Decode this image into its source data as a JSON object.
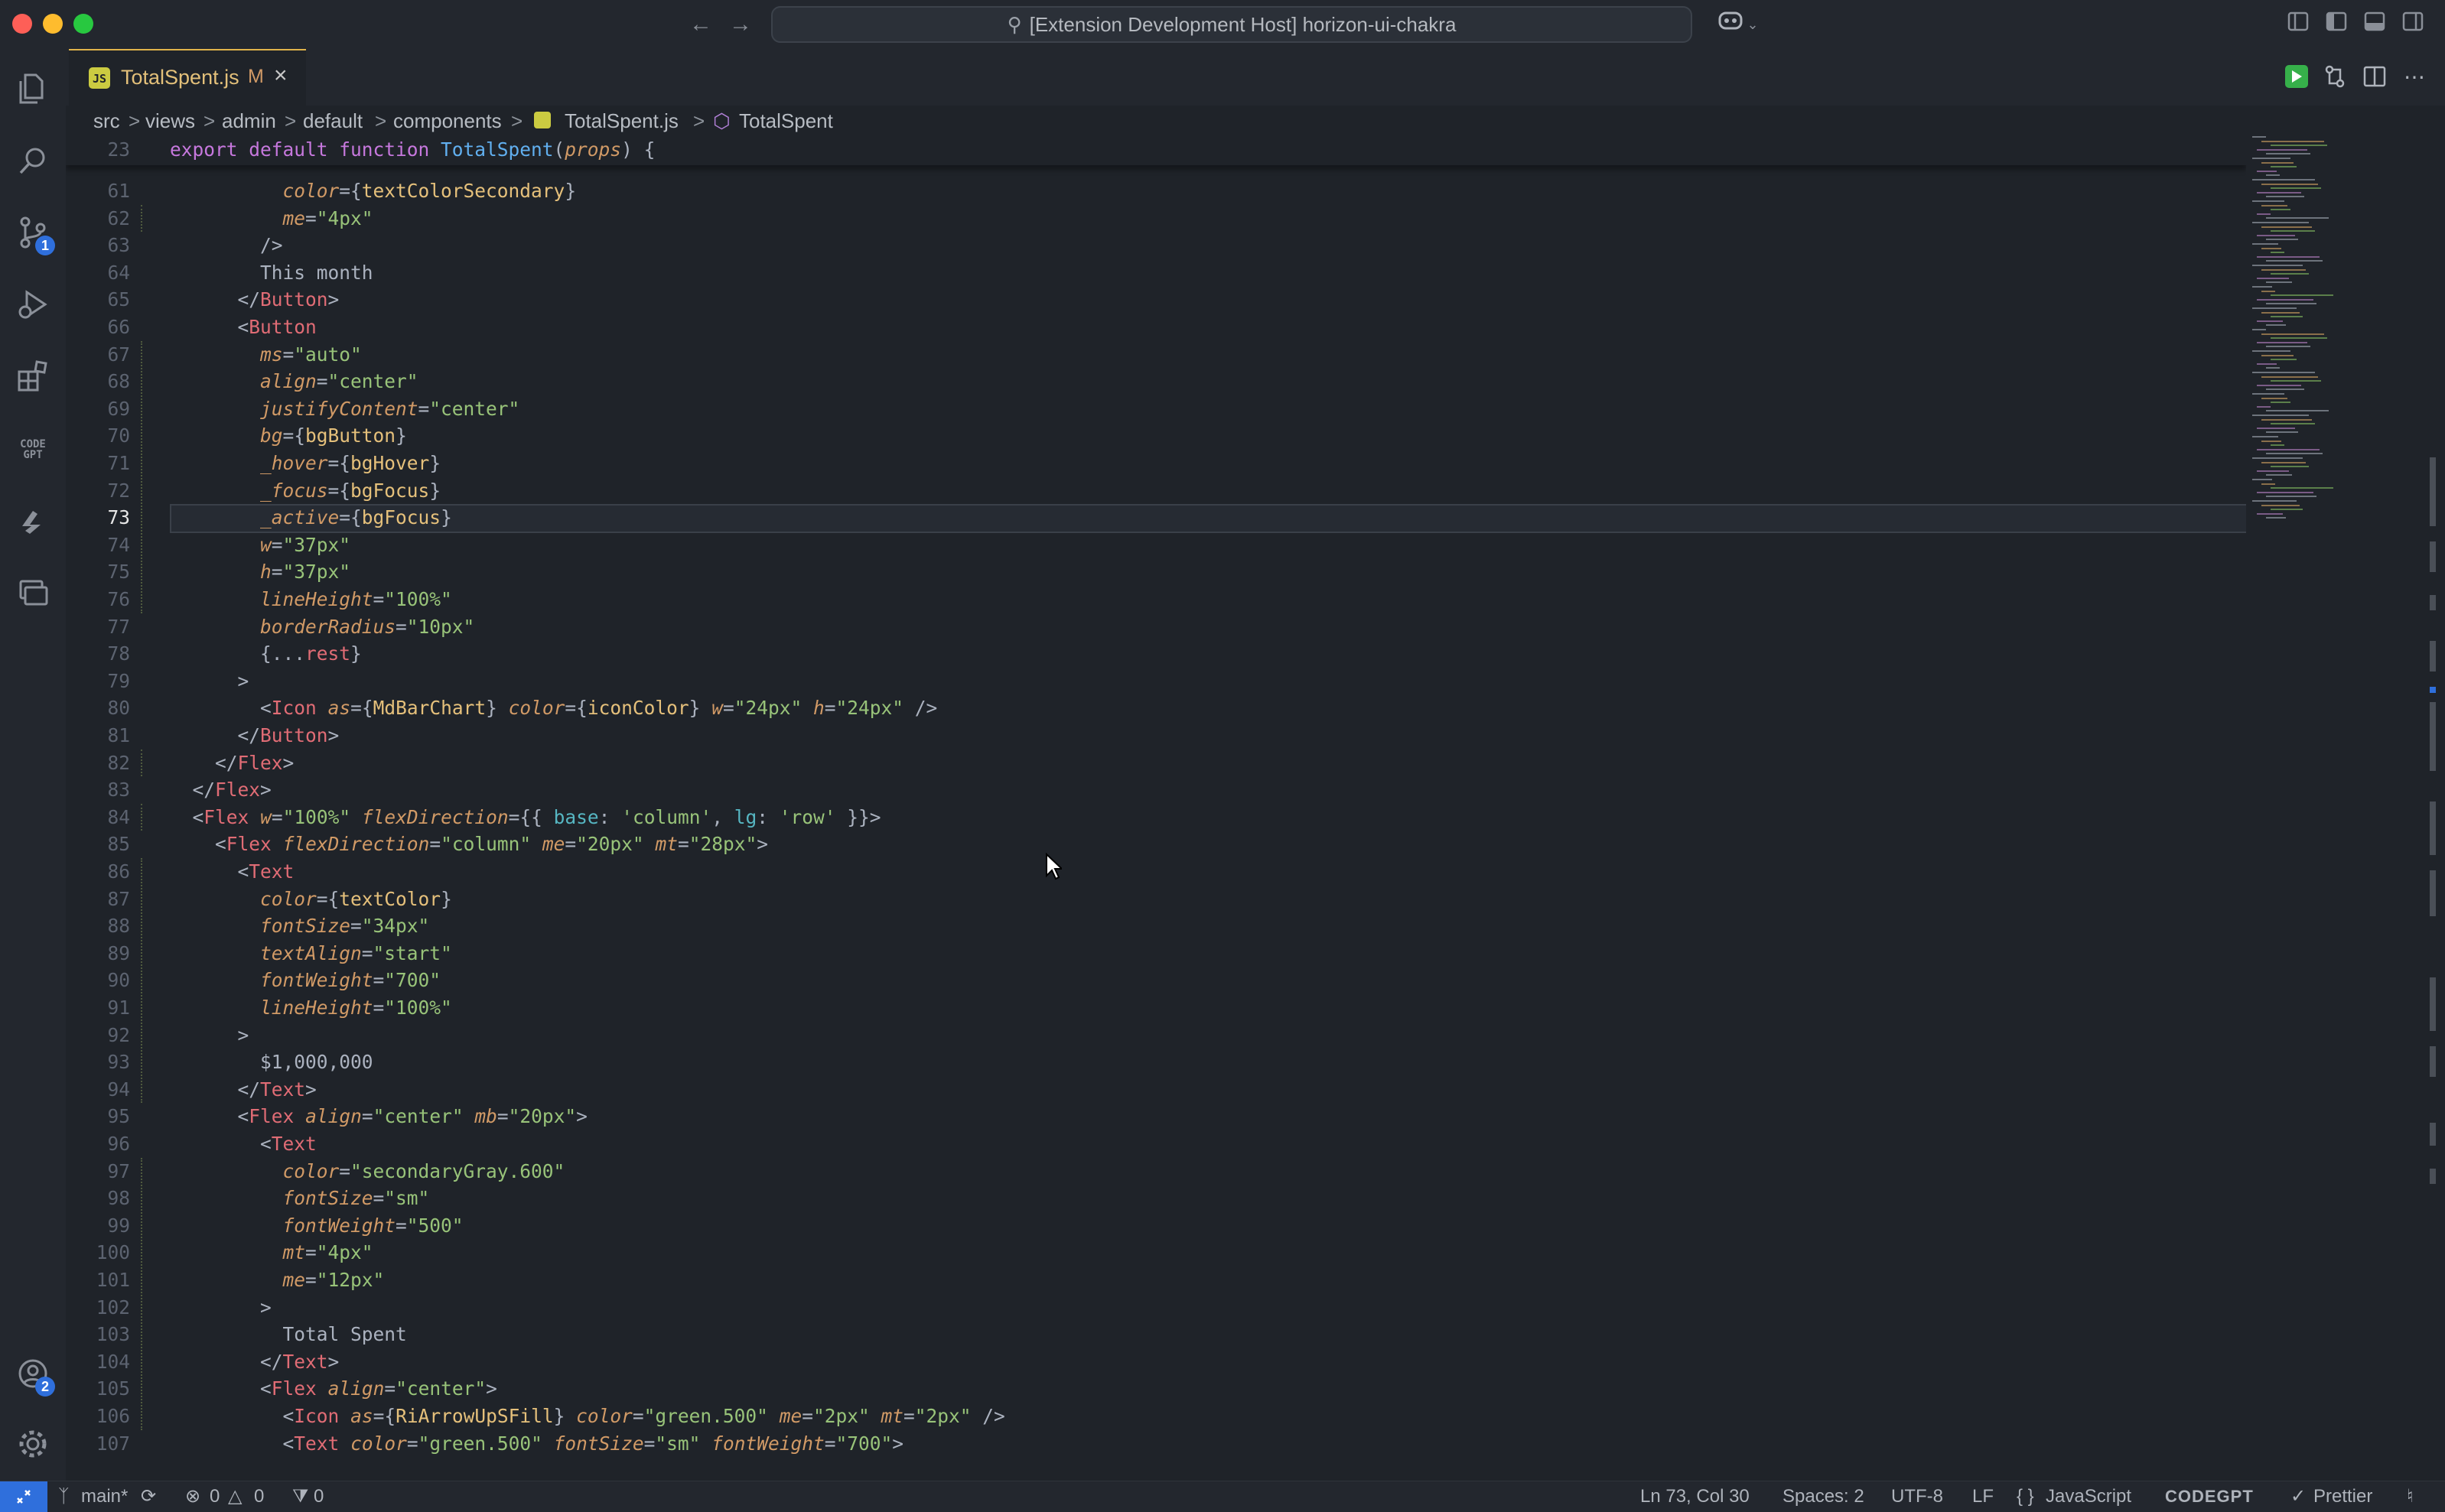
{
  "window": {
    "title": "[Extension Development Host] horizon-ui-chakra"
  },
  "tab": {
    "js_badge": "JS",
    "filename": "TotalSpent.js",
    "modified": "M"
  },
  "breadcrumb": [
    "src",
    "views",
    "admin",
    "default",
    "components",
    "TotalSpent.js",
    "TotalSpent"
  ],
  "activity": {
    "scm_badge": "1",
    "accounts_badge": "2",
    "codegpt_label": "CODE GPT"
  },
  "sticky": {
    "num": "23",
    "segs": [
      [
        "kw",
        "export default function "
      ],
      [
        "fn",
        "TotalSpent"
      ],
      [
        "pu",
        "("
      ],
      [
        "at",
        "props"
      ],
      [
        "pu",
        ") {"
      ]
    ]
  },
  "editor": {
    "cursor_line": "73",
    "lines": [
      {
        "num": "61",
        "indent": "          ",
        "segs": [
          [
            "at",
            "color"
          ],
          [
            "pu",
            "={"
          ],
          [
            "va",
            "textColorSecondary"
          ],
          [
            "pu",
            "}"
          ]
        ]
      },
      {
        "num": "62",
        "indent": "          ",
        "segs": [
          [
            "at",
            "me"
          ],
          [
            "pu",
            "="
          ],
          [
            "st",
            "\"4px\""
          ]
        ]
      },
      {
        "num": "63",
        "indent": "        ",
        "segs": [
          [
            "pu",
            "/>"
          ]
        ]
      },
      {
        "num": "64",
        "indent": "        ",
        "segs": [
          [
            "pu",
            "This month"
          ]
        ]
      },
      {
        "num": "65",
        "indent": "      ",
        "segs": [
          [
            "pu",
            "</"
          ],
          [
            "tg",
            "Button"
          ],
          [
            "pu",
            ">"
          ]
        ]
      },
      {
        "num": "66",
        "indent": "      ",
        "segs": [
          [
            "pu",
            "<"
          ],
          [
            "tg",
            "Button"
          ]
        ]
      },
      {
        "num": "67",
        "indent": "        ",
        "segs": [
          [
            "at",
            "ms"
          ],
          [
            "pu",
            "="
          ],
          [
            "st",
            "\"auto\""
          ]
        ]
      },
      {
        "num": "68",
        "indent": "        ",
        "segs": [
          [
            "at",
            "align"
          ],
          [
            "pu",
            "="
          ],
          [
            "st",
            "\"center\""
          ]
        ]
      },
      {
        "num": "69",
        "indent": "        ",
        "segs": [
          [
            "at",
            "justifyContent"
          ],
          [
            "pu",
            "="
          ],
          [
            "st",
            "\"center\""
          ]
        ]
      },
      {
        "num": "70",
        "indent": "        ",
        "segs": [
          [
            "at",
            "bg"
          ],
          [
            "pu",
            "={"
          ],
          [
            "va",
            "bgButton"
          ],
          [
            "pu",
            "}"
          ]
        ]
      },
      {
        "num": "71",
        "indent": "        ",
        "segs": [
          [
            "at",
            "_hover"
          ],
          [
            "pu",
            "={"
          ],
          [
            "va",
            "bgHover"
          ],
          [
            "pu",
            "}"
          ]
        ]
      },
      {
        "num": "72",
        "indent": "        ",
        "segs": [
          [
            "at",
            "_focus"
          ],
          [
            "pu",
            "={"
          ],
          [
            "va",
            "bgFocus"
          ],
          [
            "pu",
            "}"
          ]
        ]
      },
      {
        "num": "73",
        "indent": "        ",
        "segs": [
          [
            "at",
            "_active"
          ],
          [
            "pu",
            "={"
          ],
          [
            "va",
            "bgFocus"
          ],
          [
            "pu",
            "}"
          ]
        ]
      },
      {
        "num": "74",
        "indent": "        ",
        "segs": [
          [
            "at",
            "w"
          ],
          [
            "pu",
            "="
          ],
          [
            "st",
            "\"37px\""
          ]
        ]
      },
      {
        "num": "75",
        "indent": "        ",
        "segs": [
          [
            "at",
            "h"
          ],
          [
            "pu",
            "="
          ],
          [
            "st",
            "\"37px\""
          ]
        ]
      },
      {
        "num": "76",
        "indent": "        ",
        "segs": [
          [
            "at",
            "lineHeight"
          ],
          [
            "pu",
            "="
          ],
          [
            "st",
            "\"100%\""
          ]
        ]
      },
      {
        "num": "77",
        "indent": "        ",
        "segs": [
          [
            "at",
            "borderRadius"
          ],
          [
            "pu",
            "="
          ],
          [
            "st",
            "\"10px\""
          ]
        ]
      },
      {
        "num": "78",
        "indent": "        ",
        "segs": [
          [
            "pu",
            "{..."
          ],
          [
            "tg",
            "rest"
          ],
          [
            "pu",
            "}"
          ]
        ]
      },
      {
        "num": "79",
        "indent": "      ",
        "segs": [
          [
            "pu",
            ">"
          ]
        ]
      },
      {
        "num": "80",
        "indent": "        ",
        "segs": [
          [
            "pu",
            "<"
          ],
          [
            "tg",
            "Icon"
          ],
          [
            "pu",
            " "
          ],
          [
            "at",
            "as"
          ],
          [
            "pu",
            "={"
          ],
          [
            "va",
            "MdBarChart"
          ],
          [
            "pu",
            "} "
          ],
          [
            "at",
            "color"
          ],
          [
            "pu",
            "={"
          ],
          [
            "va",
            "iconColor"
          ],
          [
            "pu",
            "} "
          ],
          [
            "at",
            "w"
          ],
          [
            "pu",
            "="
          ],
          [
            "st",
            "\"24px\""
          ],
          [
            "pu",
            " "
          ],
          [
            "at",
            "h"
          ],
          [
            "pu",
            "="
          ],
          [
            "st",
            "\"24px\""
          ],
          [
            "pu",
            " />"
          ]
        ]
      },
      {
        "num": "81",
        "indent": "      ",
        "segs": [
          [
            "pu",
            "</"
          ],
          [
            "tg",
            "Button"
          ],
          [
            "pu",
            ">"
          ]
        ]
      },
      {
        "num": "82",
        "indent": "    ",
        "segs": [
          [
            "pu",
            "</"
          ],
          [
            "tg",
            "Flex"
          ],
          [
            "pu",
            ">"
          ]
        ]
      },
      {
        "num": "83",
        "indent": "  ",
        "segs": [
          [
            "pu",
            "</"
          ],
          [
            "tg",
            "Flex"
          ],
          [
            "pu",
            ">"
          ]
        ]
      },
      {
        "num": "84",
        "indent": "  ",
        "segs": [
          [
            "pu",
            "<"
          ],
          [
            "tg",
            "Flex"
          ],
          [
            "pu",
            " "
          ],
          [
            "at",
            "w"
          ],
          [
            "pu",
            "="
          ],
          [
            "st",
            "\"100%\""
          ],
          [
            "pu",
            " "
          ],
          [
            "at",
            "flexDirection"
          ],
          [
            "pu",
            "={{ "
          ],
          [
            "cy",
            "base"
          ],
          [
            "pu",
            ": "
          ],
          [
            "st",
            "'column'"
          ],
          [
            "pu",
            ", "
          ],
          [
            "cy",
            "lg"
          ],
          [
            "pu",
            ": "
          ],
          [
            "st",
            "'row'"
          ],
          [
            "pu",
            " }}>"
          ]
        ]
      },
      {
        "num": "85",
        "indent": "    ",
        "segs": [
          [
            "pu",
            "<"
          ],
          [
            "tg",
            "Flex"
          ],
          [
            "pu",
            " "
          ],
          [
            "at",
            "flexDirection"
          ],
          [
            "pu",
            "="
          ],
          [
            "st",
            "\"column\""
          ],
          [
            "pu",
            " "
          ],
          [
            "at",
            "me"
          ],
          [
            "pu",
            "="
          ],
          [
            "st",
            "\"20px\""
          ],
          [
            "pu",
            " "
          ],
          [
            "at",
            "mt"
          ],
          [
            "pu",
            "="
          ],
          [
            "st",
            "\"28px\""
          ],
          [
            "pu",
            ">"
          ]
        ]
      },
      {
        "num": "86",
        "indent": "      ",
        "segs": [
          [
            "pu",
            "<"
          ],
          [
            "tg",
            "Text"
          ]
        ]
      },
      {
        "num": "87",
        "indent": "        ",
        "segs": [
          [
            "at",
            "color"
          ],
          [
            "pu",
            "={"
          ],
          [
            "va",
            "textColor"
          ],
          [
            "pu",
            "}"
          ]
        ]
      },
      {
        "num": "88",
        "indent": "        ",
        "segs": [
          [
            "at",
            "fontSize"
          ],
          [
            "pu",
            "="
          ],
          [
            "st",
            "\"34px\""
          ]
        ]
      },
      {
        "num": "89",
        "indent": "        ",
        "segs": [
          [
            "at",
            "textAlign"
          ],
          [
            "pu",
            "="
          ],
          [
            "st",
            "\"start\""
          ]
        ]
      },
      {
        "num": "90",
        "indent": "        ",
        "segs": [
          [
            "at",
            "fontWeight"
          ],
          [
            "pu",
            "="
          ],
          [
            "st",
            "\"700\""
          ]
        ]
      },
      {
        "num": "91",
        "indent": "        ",
        "segs": [
          [
            "at",
            "lineHeight"
          ],
          [
            "pu",
            "="
          ],
          [
            "st",
            "\"100%\""
          ]
        ]
      },
      {
        "num": "92",
        "indent": "      ",
        "segs": [
          [
            "pu",
            ">"
          ]
        ]
      },
      {
        "num": "93",
        "indent": "        ",
        "segs": [
          [
            "pu",
            "$1,000,000"
          ]
        ]
      },
      {
        "num": "94",
        "indent": "      ",
        "segs": [
          [
            "pu",
            "</"
          ],
          [
            "tg",
            "Text"
          ],
          [
            "pu",
            ">"
          ]
        ]
      },
      {
        "num": "95",
        "indent": "      ",
        "segs": [
          [
            "pu",
            "<"
          ],
          [
            "tg",
            "Flex"
          ],
          [
            "pu",
            " "
          ],
          [
            "at",
            "align"
          ],
          [
            "pu",
            "="
          ],
          [
            "st",
            "\"center\""
          ],
          [
            "pu",
            " "
          ],
          [
            "at",
            "mb"
          ],
          [
            "pu",
            "="
          ],
          [
            "st",
            "\"20px\""
          ],
          [
            "pu",
            ">"
          ]
        ]
      },
      {
        "num": "96",
        "indent": "        ",
        "segs": [
          [
            "pu",
            "<"
          ],
          [
            "tg",
            "Text"
          ]
        ]
      },
      {
        "num": "97",
        "indent": "          ",
        "segs": [
          [
            "at",
            "color"
          ],
          [
            "pu",
            "="
          ],
          [
            "st",
            "\"secondaryGray.600\""
          ]
        ]
      },
      {
        "num": "98",
        "indent": "          ",
        "segs": [
          [
            "at",
            "fontSize"
          ],
          [
            "pu",
            "="
          ],
          [
            "st",
            "\"sm\""
          ]
        ]
      },
      {
        "num": "99",
        "indent": "          ",
        "segs": [
          [
            "at",
            "fontWeight"
          ],
          [
            "pu",
            "="
          ],
          [
            "st",
            "\"500\""
          ]
        ]
      },
      {
        "num": "100",
        "indent": "          ",
        "segs": [
          [
            "at",
            "mt"
          ],
          [
            "pu",
            "="
          ],
          [
            "st",
            "\"4px\""
          ]
        ]
      },
      {
        "num": "101",
        "indent": "          ",
        "segs": [
          [
            "at",
            "me"
          ],
          [
            "pu",
            "="
          ],
          [
            "st",
            "\"12px\""
          ]
        ]
      },
      {
        "num": "102",
        "indent": "        ",
        "segs": [
          [
            "pu",
            ">"
          ]
        ]
      },
      {
        "num": "103",
        "indent": "          ",
        "segs": [
          [
            "pu",
            "Total Spent"
          ]
        ]
      },
      {
        "num": "104",
        "indent": "        ",
        "segs": [
          [
            "pu",
            "</"
          ],
          [
            "tg",
            "Text"
          ],
          [
            "pu",
            ">"
          ]
        ]
      },
      {
        "num": "105",
        "indent": "        ",
        "segs": [
          [
            "pu",
            "<"
          ],
          [
            "tg",
            "Flex"
          ],
          [
            "pu",
            " "
          ],
          [
            "at",
            "align"
          ],
          [
            "pu",
            "="
          ],
          [
            "st",
            "\"center\""
          ],
          [
            "pu",
            ">"
          ]
        ]
      },
      {
        "num": "106",
        "indent": "          ",
        "segs": [
          [
            "pu",
            "<"
          ],
          [
            "tg",
            "Icon"
          ],
          [
            "pu",
            " "
          ],
          [
            "at",
            "as"
          ],
          [
            "pu",
            "={"
          ],
          [
            "va",
            "RiArrowUpSFill"
          ],
          [
            "pu",
            "} "
          ],
          [
            "at",
            "color"
          ],
          [
            "pu",
            "="
          ],
          [
            "st",
            "\"green.500\""
          ],
          [
            "pu",
            " "
          ],
          [
            "at",
            "me"
          ],
          [
            "pu",
            "="
          ],
          [
            "st",
            "\"2px\""
          ],
          [
            "pu",
            " "
          ],
          [
            "at",
            "mt"
          ],
          [
            "pu",
            "="
          ],
          [
            "st",
            "\"2px\""
          ],
          [
            "pu",
            " />"
          ]
        ]
      },
      {
        "num": "107",
        "indent": "          ",
        "segs": [
          [
            "pu",
            "<"
          ],
          [
            "tg",
            "Text"
          ],
          [
            "pu",
            " "
          ],
          [
            "at",
            "color"
          ],
          [
            "pu",
            "="
          ],
          [
            "st",
            "\"green.500\""
          ],
          [
            "pu",
            " "
          ],
          [
            "at",
            "fontSize"
          ],
          [
            "pu",
            "="
          ],
          [
            "st",
            "\"sm\""
          ],
          [
            "pu",
            " "
          ],
          [
            "at",
            "fontWeight"
          ],
          [
            "pu",
            "="
          ],
          [
            "st",
            "\"700\""
          ],
          [
            "pu",
            ">"
          ]
        ]
      }
    ]
  },
  "status": {
    "branch": "main*",
    "errors": "0",
    "warnings": "0",
    "ports": "0",
    "position": "Ln 73, Col 30",
    "spaces": "Spaces: 2",
    "encoding": "UTF-8",
    "eol": "LF",
    "language": "JavaScript",
    "codegpt": "CODEGPT",
    "prettier": "Prettier"
  },
  "colors": {
    "accent": "#2f6fdc",
    "run": "#36b04a",
    "tab_name": "#e3c07a"
  }
}
